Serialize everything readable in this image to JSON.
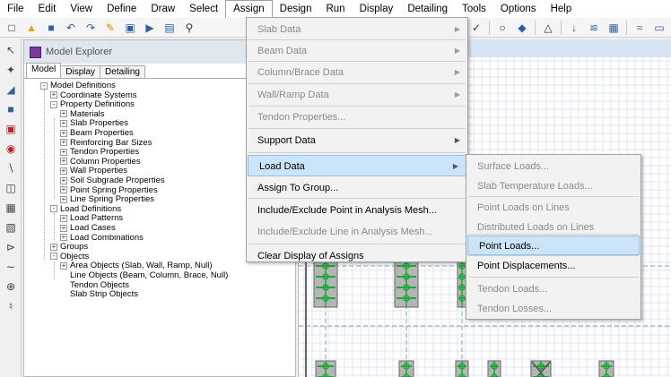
{
  "menubar": {
    "items": [
      "File",
      "Edit",
      "View",
      "Define",
      "Draw",
      "Select",
      "Assign",
      "Design",
      "Run",
      "Display",
      "Detailing",
      "Tools",
      "Options",
      "Help"
    ],
    "active": "Assign"
  },
  "explorer": {
    "title": "Model Explorer",
    "tabs": [
      "Model",
      "Display",
      "Detailing"
    ],
    "active_tab": "Model",
    "tree": [
      {
        "label": "Model Definitions",
        "toggle": "-"
      },
      {
        "label": "Coordinate Systems",
        "toggle": "+"
      },
      {
        "label": "Property Definitions",
        "toggle": "-"
      },
      {
        "label": "Materials",
        "toggle": "+"
      },
      {
        "label": "Slab Properties",
        "toggle": "+"
      },
      {
        "label": "Beam Properties",
        "toggle": "+"
      },
      {
        "label": "Reinforcing Bar Sizes",
        "toggle": "+"
      },
      {
        "label": "Tendon Properties",
        "toggle": "+"
      },
      {
        "label": "Column Properties",
        "toggle": "+"
      },
      {
        "label": "Wall Properties",
        "toggle": "+"
      },
      {
        "label": "Soil Subgrade Properties",
        "toggle": "+"
      },
      {
        "label": "Point Spring Properties",
        "toggle": "+"
      },
      {
        "label": "Line Spring Properties",
        "toggle": "+"
      },
      {
        "label": "Load Definitions",
        "toggle": "-"
      },
      {
        "label": "Load Patterns",
        "toggle": "+"
      },
      {
        "label": "Load Cases",
        "toggle": "+"
      },
      {
        "label": "Load Combinations",
        "toggle": "+"
      },
      {
        "label": "Groups",
        "toggle": "+"
      },
      {
        "label": "Objects",
        "toggle": "-"
      },
      {
        "label": "Area Objects (Slab, Wall, Ramp, Null)",
        "toggle": "+"
      },
      {
        "label": "Line Objects (Beam, Column, Brace, Null)",
        "toggle": ""
      },
      {
        "label": "Tendon Objects",
        "toggle": ""
      },
      {
        "label": "Slab Strip Objects",
        "toggle": ""
      }
    ]
  },
  "assign_menu": {
    "items": [
      {
        "label": "Slab Data",
        "arrow": "▶",
        "enabled": false
      },
      {
        "label": "Beam Data",
        "arrow": "▶",
        "enabled": false
      },
      {
        "label": "Column/Brace Data",
        "arrow": "▶",
        "enabled": false
      },
      {
        "label": "Wall/Ramp Data",
        "arrow": "▶",
        "enabled": false
      },
      {
        "label": "Tendon Properties...",
        "arrow": "",
        "enabled": false
      },
      {
        "label": "Support Data",
        "arrow": "▶",
        "enabled": true
      },
      {
        "label": "Load Data",
        "arrow": "▶",
        "enabled": true,
        "highlighted": true
      },
      {
        "label": "Assign To Group...",
        "arrow": "",
        "enabled": true
      },
      {
        "label": "Include/Exclude Point in Analysis Mesh...",
        "arrow": "",
        "enabled": true
      },
      {
        "label": "Include/Exclude Line in Analysis Mesh...",
        "arrow": "",
        "enabled": false
      },
      {
        "label": "Clear Display of Assigns",
        "arrow": "",
        "enabled": true
      }
    ]
  },
  "load_submenu": {
    "items": [
      {
        "label": "Surface Loads...",
        "enabled": false
      },
      {
        "label": "Slab Temperature Loads...",
        "enabled": false
      },
      {
        "label": "Point Loads on Lines",
        "enabled": false
      },
      {
        "label": "Distributed Loads on Lines",
        "enabled": false
      },
      {
        "label": "Point Loads...",
        "enabled": true,
        "highlighted": true
      },
      {
        "label": "Point Displacements...",
        "enabled": true
      },
      {
        "label": "Tendon Loads...",
        "enabled": false
      },
      {
        "label": "Tendon Losses...",
        "enabled": false
      }
    ]
  },
  "colors": {
    "highlight": "#cce4f7",
    "column_fill": "#b5b5b5",
    "support_green": "#1fa83a",
    "grid_blue": "#7aa0d8"
  }
}
